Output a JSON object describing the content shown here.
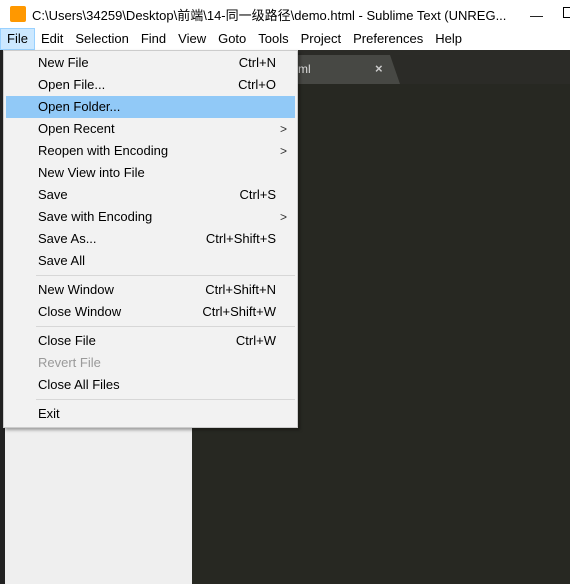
{
  "window": {
    "title": "C:\\Users\\34259\\Desktop\\前端\\14-同一级路径\\demo.html - Sublime Text (UNREG...",
    "logo_letter": "S",
    "accent": "#ff9800"
  },
  "menubar": [
    "File",
    "Edit",
    "Selection",
    "Find",
    "View",
    "Goto",
    "Tools",
    "Project",
    "Preferences",
    "Help"
  ],
  "tab": {
    "label": "ml",
    "close": "×"
  },
  "file_menu": {
    "groups": [
      [
        {
          "label": "New File",
          "shortcut": "Ctrl+N"
        },
        {
          "label": "Open File...",
          "shortcut": "Ctrl+O"
        },
        {
          "label": "Open Folder...",
          "highlighted": true
        },
        {
          "label": "Open Recent",
          "submenu": true
        },
        {
          "label": "Reopen with Encoding",
          "submenu": true
        },
        {
          "label": "New View into File"
        },
        {
          "label": "Save",
          "shortcut": "Ctrl+S"
        },
        {
          "label": "Save with Encoding",
          "submenu": true
        },
        {
          "label": "Save As...",
          "shortcut": "Ctrl+Shift+S"
        },
        {
          "label": "Save All"
        }
      ],
      [
        {
          "label": "New Window",
          "shortcut": "Ctrl+Shift+N"
        },
        {
          "label": "Close Window",
          "shortcut": "Ctrl+Shift+W"
        }
      ],
      [
        {
          "label": "Close File",
          "shortcut": "Ctrl+W"
        },
        {
          "label": "Revert File",
          "disabled": true
        },
        {
          "label": "Close All Files"
        }
      ],
      [
        {
          "label": "Exit"
        }
      ]
    ]
  }
}
